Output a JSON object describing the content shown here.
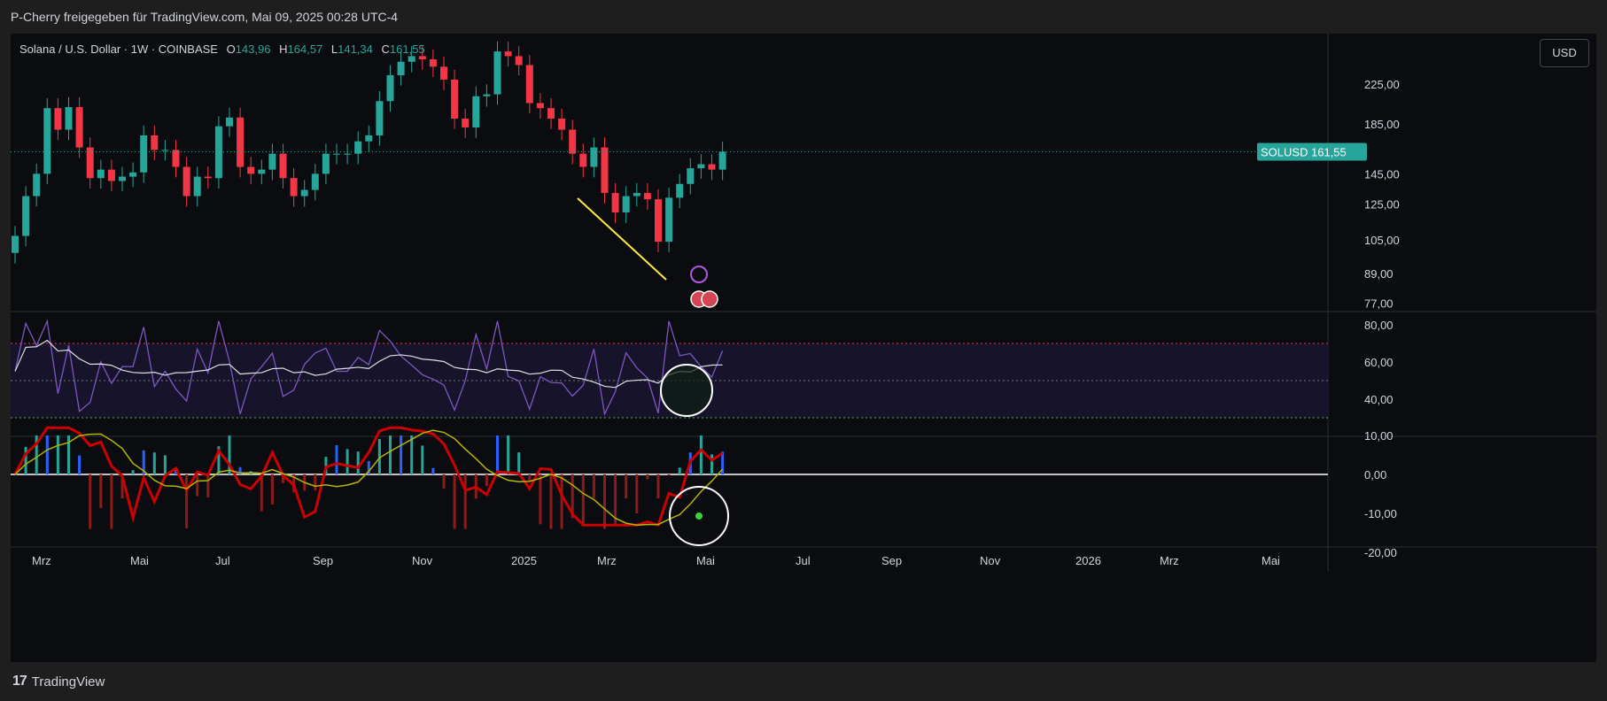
{
  "header": {
    "attribution": "P-Cherry freigegeben für TradingView.com, Mai 09, 2025 00:28 UTC-4"
  },
  "legend": {
    "title": "Solana / U.S. Dollar · 1W · COINBASE",
    "o_label": "O",
    "o_value": "143,96",
    "h_label": "H",
    "h_value": "164,57",
    "l_label": "L",
    "l_value": "141,34",
    "c_label": "C",
    "c_value": "161,55"
  },
  "currency_button": "USD",
  "footer": {
    "logo_mark": "17",
    "brand": "TradingView"
  },
  "colors": {
    "up": "#26a69a",
    "down": "#f23645",
    "rsi": "#7e57c2",
    "macd": "#cc0000",
    "signal": "#b5b500",
    "trendline": "#ffeb3b",
    "price_tag": "#26a69a"
  },
  "chart_data": {
    "type": "candlestick",
    "price_axis": {
      "ticks": [
        "225,00",
        "185,00",
        "145,00",
        "125,00",
        "105,00",
        "89,00",
        "77,00"
      ],
      "tick_values": [
        225,
        185,
        145,
        125,
        105,
        89,
        77
      ],
      "scale": "log"
    },
    "current_price": {
      "symbol": "SOLUSD",
      "value": "161,55",
      "numeric": 161.55
    },
    "time_axis": {
      "labels": [
        "Mrz",
        "Mai",
        "Jul",
        "Sep",
        "Nov",
        "2025",
        "Mrz",
        "Mai",
        "Jul",
        "Sep",
        "Nov",
        "2026",
        "Mrz",
        "Mai"
      ]
    },
    "candles_close": [
      107,
      130,
      145,
      200,
      180,
      201,
      165,
      142,
      148,
      140,
      143,
      146,
      175,
      163,
      163,
      150,
      130,
      143,
      142,
      183,
      191,
      150,
      145,
      148,
      160,
      142,
      130,
      134,
      145,
      160,
      160,
      160,
      170,
      175,
      207,
      235,
      251,
      258,
      254,
      245,
      230,
      190,
      182,
      212,
      214,
      264,
      258,
      247,
      205,
      200,
      190,
      180,
      160,
      150,
      165,
      132,
      120,
      130,
      132,
      128,
      104,
      129,
      138,
      149,
      152,
      148,
      161.55
    ],
    "rsi": {
      "ticks": [
        "80,00",
        "60,00",
        "40,00"
      ],
      "tick_values": [
        80,
        60,
        40
      ],
      "upper": 70,
      "middle": 50,
      "lower": 30
    },
    "macd": {
      "ticks": [
        "10,00",
        "0,00",
        "-10,00",
        "-20,00"
      ],
      "tick_values": [
        10,
        0,
        -10,
        -20
      ]
    }
  }
}
